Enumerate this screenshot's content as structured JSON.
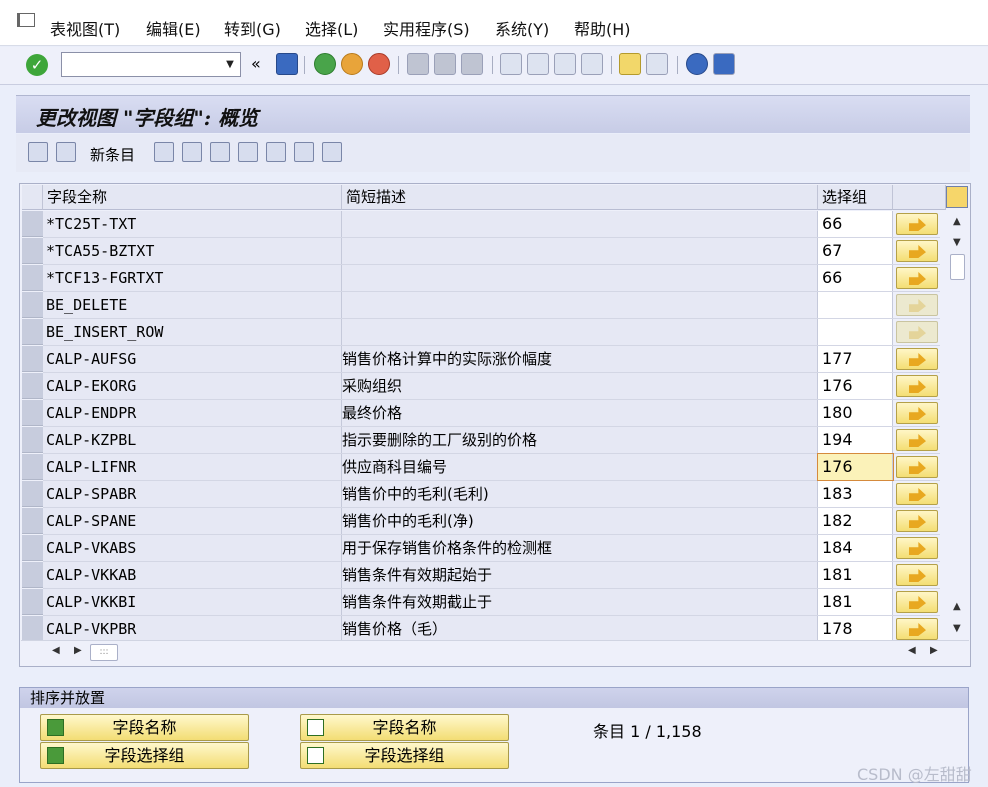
{
  "menu": [
    "表视图(T)",
    "编辑(E)",
    "转到(G)",
    "选择(L)",
    "实用程序(S)",
    "系统(Y)",
    "帮助(H)"
  ],
  "toolbar": {
    "command_value": "",
    "icons": [
      "enter-icon",
      "back-icon",
      "save-icon",
      "back-nav-icon",
      "exit-icon",
      "cancel-icon",
      "print-icon",
      "find-icon",
      "find-next-icon",
      "first-page-icon",
      "prev-page-icon",
      "next-page-icon",
      "last-page-icon",
      "new-session-icon",
      "shortcut-icon",
      "help-icon",
      "customize-layout-icon"
    ]
  },
  "title": "更改视图 \"字段组\": 概览",
  "app_toolbar": {
    "new_entries": "新条目"
  },
  "table": {
    "headers": [
      "字段全称",
      "简短描述",
      "选择组"
    ],
    "rows": [
      {
        "field": "*TC25T-TXT",
        "desc": "",
        "group": "66"
      },
      {
        "field": "*TCA55-BZTXT",
        "desc": "",
        "group": "67"
      },
      {
        "field": "*TCF13-FGRTXT",
        "desc": "",
        "group": "66"
      },
      {
        "field": "BE_DELETE",
        "desc": "",
        "group": "",
        "disabled": true
      },
      {
        "field": "BE_INSERT_ROW",
        "desc": "",
        "group": "",
        "disabled": true
      },
      {
        "field": "CALP-AUFSG",
        "desc": "销售价格计算中的实际涨价幅度",
        "group": "177"
      },
      {
        "field": "CALP-EKORG",
        "desc": "采购组织",
        "group": "176"
      },
      {
        "field": "CALP-ENDPR",
        "desc": "最终价格",
        "group": "180"
      },
      {
        "field": "CALP-KZPBL",
        "desc": "指示要删除的工厂级别的价格",
        "group": "194"
      },
      {
        "field": "CALP-LIFNR",
        "desc": "供应商科目编号",
        "group": "176",
        "highlight": true
      },
      {
        "field": "CALP-SPABR",
        "desc": "销售价中的毛利(毛利)",
        "group": "183"
      },
      {
        "field": "CALP-SPANE",
        "desc": "销售价中的毛利(净)",
        "group": "182"
      },
      {
        "field": "CALP-VKABS",
        "desc": "用于保存销售价格条件的检测框",
        "group": "184"
      },
      {
        "field": "CALP-VKKAB",
        "desc": "销售条件有效期起始于",
        "group": "181"
      },
      {
        "field": "CALP-VKKBI",
        "desc": "销售条件有效期截止于",
        "group": "181"
      },
      {
        "field": "CALP-VKPBR",
        "desc": "销售价格（毛）",
        "group": "178"
      }
    ]
  },
  "sort_group": {
    "title": "排序并放置",
    "sort_by_name": "字段名称",
    "sort_by_group": "字段选择组",
    "position_by_name": "字段名称",
    "position_by_group": "字段选择组",
    "entries": "条目 1 / 1,158"
  },
  "watermark": "CSDN @左甜甜"
}
